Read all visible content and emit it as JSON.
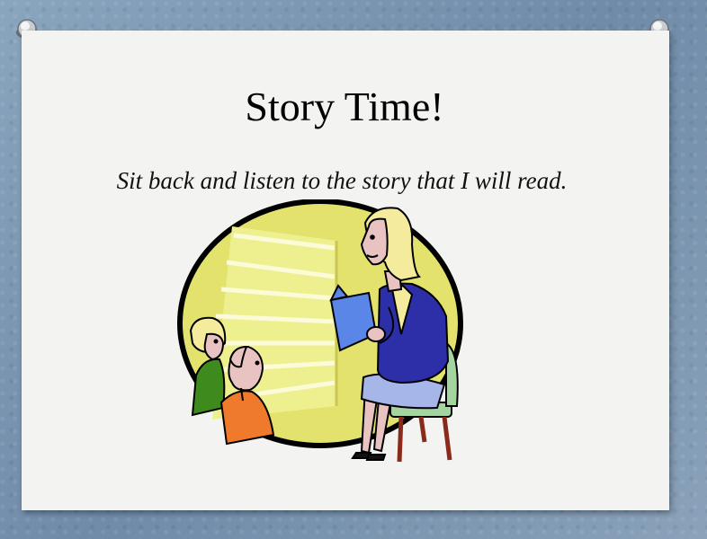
{
  "slide": {
    "title": "Story Time!",
    "subtitle": "Sit back and listen to the story that I will read."
  },
  "clipart": {
    "icon": "teacher-reading-to-children-illustration"
  },
  "colors": {
    "background": "#7b97b3",
    "slide": "#f3f3f2",
    "oval_fill": "#e3e26d",
    "book": "#5a86e8",
    "jacket": "#2c2fa8",
    "skirt": "#a6b6e8",
    "chair": "#a4d4a0",
    "child_shirt_orange": "#f07a2b",
    "child_shirt_green": "#3f8a1d",
    "hair": "#f4eb9c"
  }
}
